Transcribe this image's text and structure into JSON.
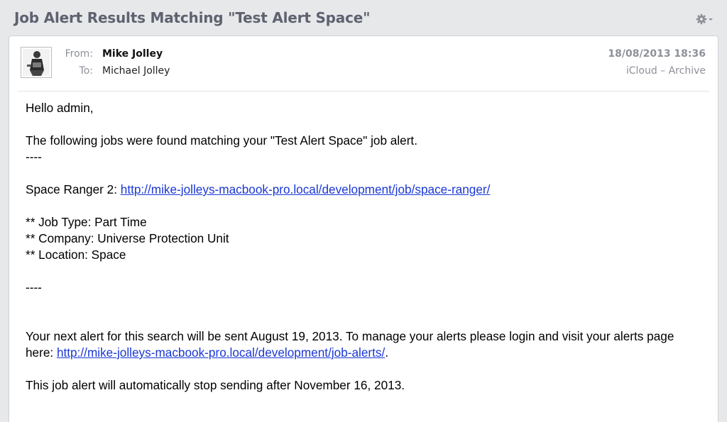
{
  "header": {
    "subject": "Job Alert Results Matching \"Test Alert Space\""
  },
  "message": {
    "from_label": "From:",
    "from_name": "Mike Jolley",
    "to_label": "To:",
    "to_name": "Michael Jolley",
    "date": "18/08/2013 18:36",
    "mailbox": "iCloud – Archive",
    "icons": {
      "actions": "gear-icon",
      "sender": "avatar"
    }
  },
  "body": {
    "greeting": "Hello admin,",
    "intro": "The following jobs were found matching your \"Test Alert Space\" job alert.",
    "separator": "----",
    "job_title_prefix": "Space Ranger 2: ",
    "job_link": "http://mike-jolleys-macbook-pro.local/development/job/space-ranger/",
    "job_type": "** Job Type: Part Time",
    "company": "** Company: Universe Protection Unit",
    "location": "** Location: Space",
    "separator_end": "----",
    "next_alert_text": "Your next alert for this search will be sent August 19, 2013. To manage your alerts please login and visit your alerts page here: ",
    "alerts_link": "http://mike-jolleys-macbook-pro.local/development/job-alerts/",
    "period": ".",
    "stop_text": "This job alert will automatically stop sending after November 16, 2013."
  }
}
